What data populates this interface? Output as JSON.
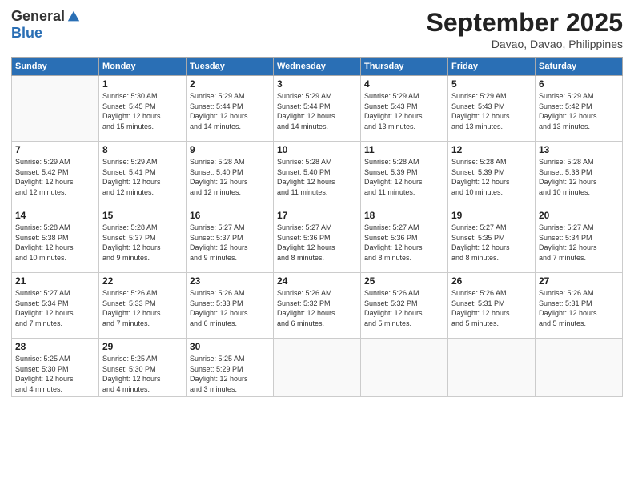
{
  "logo": {
    "general": "General",
    "blue": "Blue"
  },
  "title": "September 2025",
  "subtitle": "Davao, Davao, Philippines",
  "weekdays": [
    "Sunday",
    "Monday",
    "Tuesday",
    "Wednesday",
    "Thursday",
    "Friday",
    "Saturday"
  ],
  "weeks": [
    [
      {
        "day": "",
        "info": ""
      },
      {
        "day": "1",
        "info": "Sunrise: 5:30 AM\nSunset: 5:45 PM\nDaylight: 12 hours\nand 15 minutes."
      },
      {
        "day": "2",
        "info": "Sunrise: 5:29 AM\nSunset: 5:44 PM\nDaylight: 12 hours\nand 14 minutes."
      },
      {
        "day": "3",
        "info": "Sunrise: 5:29 AM\nSunset: 5:44 PM\nDaylight: 12 hours\nand 14 minutes."
      },
      {
        "day": "4",
        "info": "Sunrise: 5:29 AM\nSunset: 5:43 PM\nDaylight: 12 hours\nand 13 minutes."
      },
      {
        "day": "5",
        "info": "Sunrise: 5:29 AM\nSunset: 5:43 PM\nDaylight: 12 hours\nand 13 minutes."
      },
      {
        "day": "6",
        "info": "Sunrise: 5:29 AM\nSunset: 5:42 PM\nDaylight: 12 hours\nand 13 minutes."
      }
    ],
    [
      {
        "day": "7",
        "info": "Sunrise: 5:29 AM\nSunset: 5:42 PM\nDaylight: 12 hours\nand 12 minutes."
      },
      {
        "day": "8",
        "info": "Sunrise: 5:29 AM\nSunset: 5:41 PM\nDaylight: 12 hours\nand 12 minutes."
      },
      {
        "day": "9",
        "info": "Sunrise: 5:28 AM\nSunset: 5:40 PM\nDaylight: 12 hours\nand 12 minutes."
      },
      {
        "day": "10",
        "info": "Sunrise: 5:28 AM\nSunset: 5:40 PM\nDaylight: 12 hours\nand 11 minutes."
      },
      {
        "day": "11",
        "info": "Sunrise: 5:28 AM\nSunset: 5:39 PM\nDaylight: 12 hours\nand 11 minutes."
      },
      {
        "day": "12",
        "info": "Sunrise: 5:28 AM\nSunset: 5:39 PM\nDaylight: 12 hours\nand 10 minutes."
      },
      {
        "day": "13",
        "info": "Sunrise: 5:28 AM\nSunset: 5:38 PM\nDaylight: 12 hours\nand 10 minutes."
      }
    ],
    [
      {
        "day": "14",
        "info": "Sunrise: 5:28 AM\nSunset: 5:38 PM\nDaylight: 12 hours\nand 10 minutes."
      },
      {
        "day": "15",
        "info": "Sunrise: 5:28 AM\nSunset: 5:37 PM\nDaylight: 12 hours\nand 9 minutes."
      },
      {
        "day": "16",
        "info": "Sunrise: 5:27 AM\nSunset: 5:37 PM\nDaylight: 12 hours\nand 9 minutes."
      },
      {
        "day": "17",
        "info": "Sunrise: 5:27 AM\nSunset: 5:36 PM\nDaylight: 12 hours\nand 8 minutes."
      },
      {
        "day": "18",
        "info": "Sunrise: 5:27 AM\nSunset: 5:36 PM\nDaylight: 12 hours\nand 8 minutes."
      },
      {
        "day": "19",
        "info": "Sunrise: 5:27 AM\nSunset: 5:35 PM\nDaylight: 12 hours\nand 8 minutes."
      },
      {
        "day": "20",
        "info": "Sunrise: 5:27 AM\nSunset: 5:34 PM\nDaylight: 12 hours\nand 7 minutes."
      }
    ],
    [
      {
        "day": "21",
        "info": "Sunrise: 5:27 AM\nSunset: 5:34 PM\nDaylight: 12 hours\nand 7 minutes."
      },
      {
        "day": "22",
        "info": "Sunrise: 5:26 AM\nSunset: 5:33 PM\nDaylight: 12 hours\nand 7 minutes."
      },
      {
        "day": "23",
        "info": "Sunrise: 5:26 AM\nSunset: 5:33 PM\nDaylight: 12 hours\nand 6 minutes."
      },
      {
        "day": "24",
        "info": "Sunrise: 5:26 AM\nSunset: 5:32 PM\nDaylight: 12 hours\nand 6 minutes."
      },
      {
        "day": "25",
        "info": "Sunrise: 5:26 AM\nSunset: 5:32 PM\nDaylight: 12 hours\nand 5 minutes."
      },
      {
        "day": "26",
        "info": "Sunrise: 5:26 AM\nSunset: 5:31 PM\nDaylight: 12 hours\nand 5 minutes."
      },
      {
        "day": "27",
        "info": "Sunrise: 5:26 AM\nSunset: 5:31 PM\nDaylight: 12 hours\nand 5 minutes."
      }
    ],
    [
      {
        "day": "28",
        "info": "Sunrise: 5:25 AM\nSunset: 5:30 PM\nDaylight: 12 hours\nand 4 minutes."
      },
      {
        "day": "29",
        "info": "Sunrise: 5:25 AM\nSunset: 5:30 PM\nDaylight: 12 hours\nand 4 minutes."
      },
      {
        "day": "30",
        "info": "Sunrise: 5:25 AM\nSunset: 5:29 PM\nDaylight: 12 hours\nand 3 minutes."
      },
      {
        "day": "",
        "info": ""
      },
      {
        "day": "",
        "info": ""
      },
      {
        "day": "",
        "info": ""
      },
      {
        "day": "",
        "info": ""
      }
    ]
  ]
}
